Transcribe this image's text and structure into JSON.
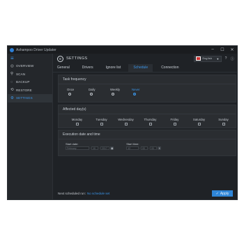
{
  "app": {
    "title": "Ashampoo Driver Updater"
  },
  "window_controls": {
    "minimize": "–",
    "maximize": "☐",
    "close": "✕"
  },
  "sidebar": {
    "menu_icon": "≡",
    "items": [
      {
        "label": "OVERVIEW",
        "icon": "◎"
      },
      {
        "label": "SCAN",
        "icon": "⚲"
      },
      {
        "label": "BACKUP",
        "icon": "◌"
      },
      {
        "label": "RESTORE",
        "icon": "⟲"
      },
      {
        "label": "SETTINGS",
        "icon": "⚙"
      }
    ]
  },
  "header": {
    "title": "SETTINGS",
    "language": "English",
    "language_arrow": "▼",
    "help_icon": "?",
    "info_icon": "ⓘ"
  },
  "tabs": [
    "General",
    "Drivers",
    "Ignore list",
    "Schedule",
    "Connection"
  ],
  "frequency": {
    "title": "Task frequency",
    "options": [
      "Once",
      "Daily",
      "Weekly",
      "Never"
    ],
    "selected": "Never"
  },
  "days": {
    "title": "Affected day(s)",
    "items": [
      "Monday",
      "Tuesday",
      "Wednesday",
      "Thursday",
      "Friday",
      "Saturday",
      "Sunday"
    ]
  },
  "execution": {
    "title": "Execution date and time",
    "start_date_label": "Start date:",
    "start_date": {
      "month": "February",
      "day": "10",
      "year": "2017",
      "calendar_icon": "▦"
    },
    "start_time_label": "Start time:",
    "start_time": {
      "hour": "12",
      "minute": "00",
      "second": "00",
      "spin_icon": "⇕"
    }
  },
  "footer": {
    "next_label": "Next scheduled run:",
    "next_value": "No schedule set",
    "apply_label": "Apply",
    "apply_icon": "✓"
  },
  "colors": {
    "accent": "#2f86d8",
    "background": "#1f2226",
    "sidebar": "#24272b"
  }
}
